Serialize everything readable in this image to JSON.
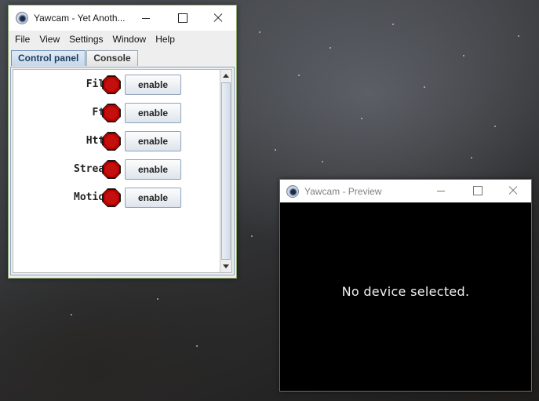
{
  "main_window": {
    "title": "Yawcam - Yet Anoth...",
    "menu": [
      "File",
      "View",
      "Settings",
      "Window",
      "Help"
    ],
    "tabs": [
      "Control panel",
      "Console"
    ],
    "active_tab": "Control panel",
    "services": [
      {
        "label": "File",
        "status": "stopped",
        "button": "enable"
      },
      {
        "label": "Ftp",
        "status": "stopped",
        "button": "enable"
      },
      {
        "label": "Http",
        "status": "stopped",
        "button": "enable"
      },
      {
        "label": "Stream",
        "status": "stopped",
        "button": "enable"
      },
      {
        "label": "Motion",
        "status": "stopped",
        "button": "enable"
      }
    ]
  },
  "preview_window": {
    "title": "Yawcam - Preview",
    "message": "No device selected."
  },
  "colors": {
    "stop_indicator": "#c40f0f",
    "tab_active": "#c6d8ec",
    "preview_bg": "#000000"
  },
  "icons": {
    "app": "yawcam-webcam-icon",
    "status": "stop-octagon-icon"
  }
}
